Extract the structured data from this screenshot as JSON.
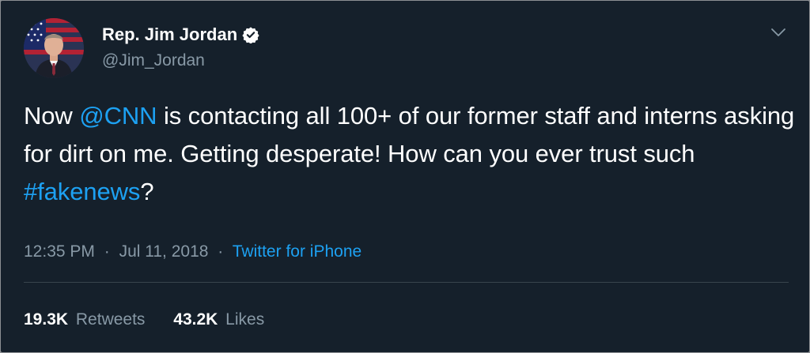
{
  "author": {
    "display_name": "Rep. Jim Jordan",
    "handle": "@Jim_Jordan",
    "verified": true
  },
  "tweet": {
    "text_parts": {
      "p1": "Now ",
      "mention": "@CNN",
      "p2": " is contacting all 100+ of our former staff and interns asking for dirt on me. Getting desperate! How can you ever trust such ",
      "hashtag": "#fakenews",
      "p3": "?"
    },
    "time": "12:35 PM",
    "date": "Jul 11, 2018",
    "separator": "·",
    "source": "Twitter for iPhone"
  },
  "stats": {
    "retweets_count": "19.3K",
    "retweets_label": "Retweets",
    "likes_count": "43.2K",
    "likes_label": "Likes"
  },
  "icons": {
    "verified": "verified-badge-icon",
    "menu": "chevron-down-icon"
  },
  "colors": {
    "background": "#15202b",
    "link": "#1da1f2",
    "secondary_text": "#8899a6",
    "divider": "#38444d"
  }
}
